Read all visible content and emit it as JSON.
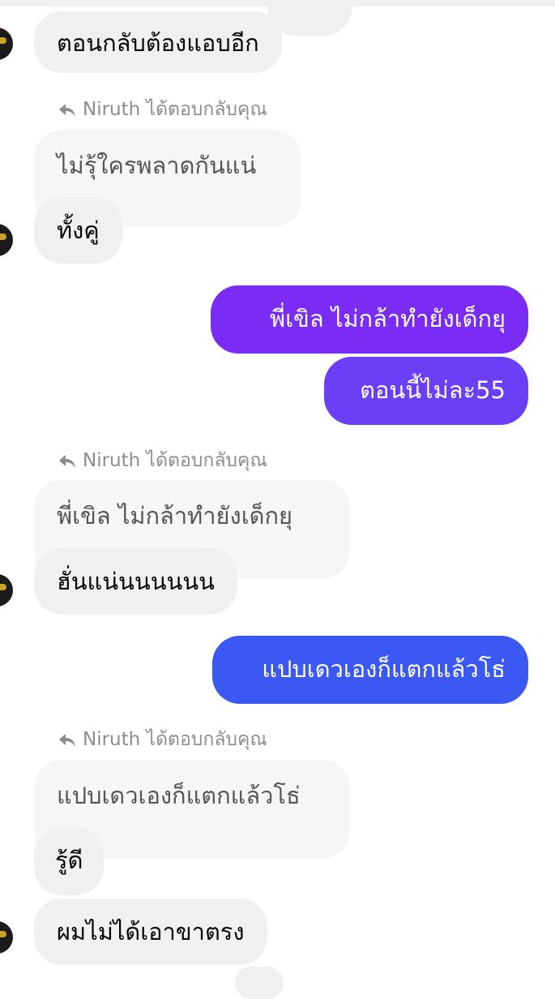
{
  "colors": {
    "incoming_bg": "#f0f0f0",
    "outgoing_purple": "#7a2cf4",
    "outgoing_blue": "#3b59f2",
    "hint": "#8a8d91"
  },
  "icons": {
    "reply": "reply-arrow-icon",
    "avatar": "avatar"
  },
  "messages": [
    {
      "type": "incoming",
      "text": "ตอนกลับต้องแอบอีก"
    },
    {
      "type": "reply_hint",
      "text": "Niruth ได้ตอบกลับคุณ"
    },
    {
      "type": "quoted",
      "text": "ไม่รุ้ใครพลาดกันแน่"
    },
    {
      "type": "incoming",
      "text": "ทั้งคู่"
    },
    {
      "type": "outgoing",
      "text": "พี่เขิล ไม่กล้าทำยังเด็กยุ"
    },
    {
      "type": "outgoing",
      "text": "ตอนนี้ไม่ละ55"
    },
    {
      "type": "reply_hint",
      "text": "Niruth ได้ตอบกลับคุณ"
    },
    {
      "type": "quoted",
      "text": "พี่เขิล ไม่กล้าทำยังเด็กยุ"
    },
    {
      "type": "incoming",
      "text": "ฮั่นแน่นนนนนน"
    },
    {
      "type": "outgoing",
      "text": "แปบเดวเองก็แตกแล้วโธ่"
    },
    {
      "type": "reply_hint",
      "text": "Niruth ได้ตอบกลับคุณ"
    },
    {
      "type": "quoted",
      "text": "แปบเดวเองก็แตกแล้วโธ่"
    },
    {
      "type": "incoming",
      "text": "รู้ดี"
    },
    {
      "type": "incoming",
      "text": "ผมไม่ได้เอาขาตรง"
    }
  ]
}
